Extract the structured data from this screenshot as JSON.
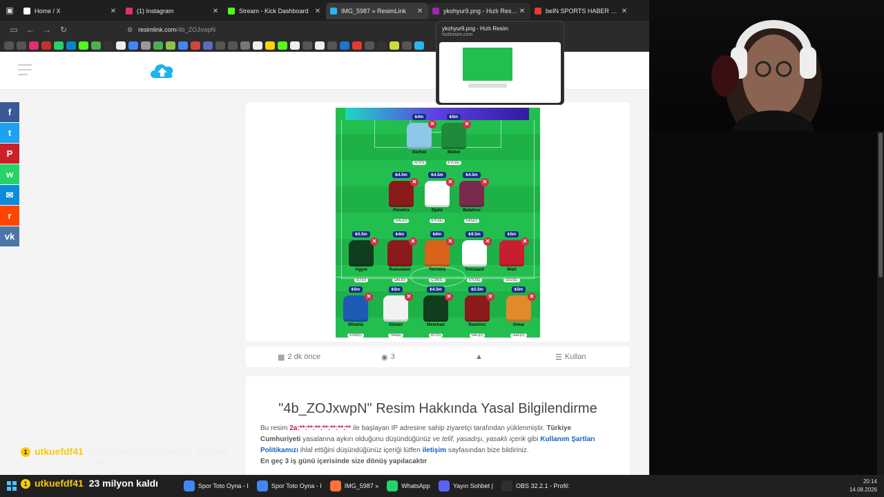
{
  "browser": {
    "tabs": [
      {
        "label": "Home / X",
        "favicon_color": "#ffffff"
      },
      {
        "label": "(1) Instagram",
        "favicon_color": "#e1306c"
      },
      {
        "label": "Stream - Kick Dashboard",
        "favicon_color": "#53fc18"
      },
      {
        "label": "IMG_5987 » ResimLink",
        "favicon_color": "#29b6f6"
      },
      {
        "label": "ykohyur9.png - Hızlı Resim",
        "favicon_color": "#9c27b0"
      },
      {
        "label": "beIN SPORTS HABER Canlı Yayın",
        "favicon_color": "#e53935"
      }
    ],
    "url_domain": "resimlink.com",
    "url_path": "/4b_ZOJxwpN",
    "preview": {
      "title": "ykohyur9.png - Hızlı Resim",
      "url": "hizliresim.com"
    }
  },
  "share_buttons": [
    {
      "name": "facebook",
      "glyph": "f",
      "color": "#3b5998"
    },
    {
      "name": "twitter",
      "glyph": "t",
      "color": "#1da1f2"
    },
    {
      "name": "pinterest",
      "glyph": "P",
      "color": "#cb2027"
    },
    {
      "name": "whatsapp",
      "glyph": "w",
      "color": "#25d366"
    },
    {
      "name": "email",
      "glyph": "✉",
      "color": "#0d8bd9"
    },
    {
      "name": "reddit",
      "glyph": "r",
      "color": "#ff4500"
    },
    {
      "name": "vk",
      "glyph": "vk",
      "color": "#4a76a8"
    }
  ],
  "players": [
    {
      "name": "Serhat",
      "team": "IST(D)",
      "price": "₺4m",
      "color": "#8ec8e8",
      "row": 0,
      "col": 0
    },
    {
      "name": "Nübel",
      "team": "EYÜ(E)",
      "price": "₺5m",
      "color": "#1e8a3a",
      "row": 0,
      "col": 1
    },
    {
      "name": "Penetra",
      "team": "GAL(D)",
      "price": "₺4.5m",
      "color": "#8b1a1a",
      "row": 1,
      "col": 0
    },
    {
      "name": "Djaló",
      "team": "EYÜ(E)",
      "price": "₺4.5m",
      "color": "#ffffff",
      "row": 1,
      "col": 1
    },
    {
      "name": "Batahov",
      "team": "KAS(D)",
      "price": "₺4.5m",
      "color": "#7a2a4a",
      "row": 1,
      "col": 2
    },
    {
      "name": "Agyei",
      "team": "IST(D)",
      "price": "₺5.5m",
      "color": "#0f3d1e",
      "row": 2,
      "col": 0
    },
    {
      "name": "Ramadani",
      "team": "GAL(D)",
      "price": "₺4m",
      "color": "#8b1a1a",
      "row": 2,
      "col": 1
    },
    {
      "name": "Torreira",
      "team": "ÇOR(E)",
      "price": "₺6m",
      "color": "#d9631b",
      "row": 2,
      "col": 2
    },
    {
      "name": "Trossard",
      "team": "EYÜ(E)",
      "price": "₺9.5m",
      "color": "#ffffff",
      "row": 2,
      "col": 3
    },
    {
      "name": "Watt",
      "team": "GÖZ(E)",
      "price": "₺5m",
      "color": "#c81e2f",
      "row": 2,
      "col": 4
    },
    {
      "name": "Mihâilă",
      "team": "KON(D)",
      "price": "₺5m",
      "color": "#1e5bb5",
      "row": 3,
      "col": 0
    },
    {
      "name": "Güven",
      "team": "TRA(E)",
      "price": "₺5m",
      "color": "#f2f2f2",
      "row": 3,
      "col": 1
    },
    {
      "name": "Metehan",
      "team": "IST(D)",
      "price": "₺4.5m",
      "color": "#0f3d1e",
      "row": 3,
      "col": 2
    },
    {
      "name": "Ramirez",
      "team": "GAL(D)",
      "price": "₺5.5m",
      "color": "#8b1a1a",
      "row": 3,
      "col": 3
    },
    {
      "name": "Omar",
      "team": "GAZ(D)",
      "price": "₺5m",
      "color": "#e08a2c",
      "row": 3,
      "col": 4
    }
  ],
  "stats": {
    "time": "2 dk önce",
    "views": "3",
    "use_label": "Kullan"
  },
  "legal": {
    "title": "\"4b_ZOJxwpN\" Resim Hakkında Yasal Bilgilendirme",
    "p1": "Bu resim ",
    "ip": "2a:**:**:**:**:**:**:**",
    "p2": " ile başlayan IP adresine sahip ziyaretçi tarafından yüklenmiştir. ",
    "p3": "Türkiye Cumhuriyeti",
    "p4": " yasalarına aykırı olduğunu düşündüğünüz ve ",
    "p5": "telif, yasadışı, yasaklı içerik",
    "p6": " gibi ",
    "p7": "Kullanım Şartları Politikamızı",
    "p8": " ihlal ettiğini düşündüğünüz içeriği lütfen ",
    "p9": "iletişim",
    "p10": " sayfasından bize bildiriniz.",
    "p11": "En geç 3 iş günü içerisinde size dönüş yapılacaktır"
  },
  "chat": {
    "user": "utkuefdf41",
    "msg": "https://resimlink.com/4b_ZOJxwpN",
    "user2": "utkuefdf41",
    "msg2": "23 milyon kaldı"
  },
  "taskbar": {
    "items": [
      {
        "label": "Spor Toto Oyna - I",
        "color": "#4285f4"
      },
      {
        "label": "Spor Toto Oyna - I",
        "color": "#4285f4"
      },
      {
        "label": "IMG_5987 »",
        "color": "#ff7139"
      },
      {
        "label": "WhatsApp",
        "color": "#25d366"
      },
      {
        "label": "Yayın Sohbet |",
        "color": "#5865f2"
      },
      {
        "label": "OBS 32.2.1 - Profil:",
        "color": "#302e31"
      }
    ],
    "time": "20:14",
    "date": "14.08.2026"
  }
}
